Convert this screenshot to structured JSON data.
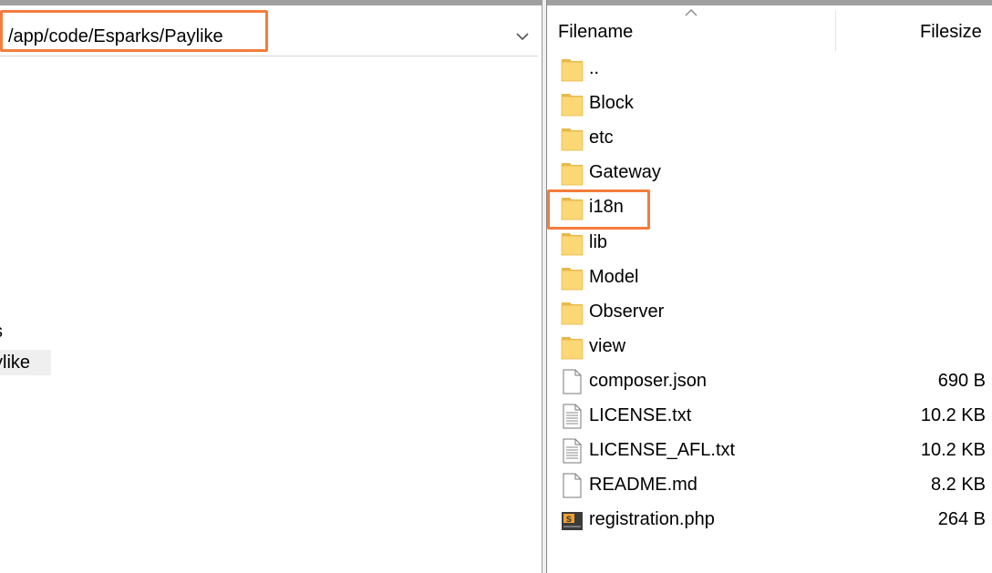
{
  "local": {
    "path_value": "/app/code/Esparks/Paylike",
    "tree_items": [
      {
        "label": "s"
      },
      {
        "label": "ylike"
      }
    ]
  },
  "remote": {
    "columns": {
      "filename": "Filename",
      "filesize": "Filesize"
    },
    "files": [
      {
        "name": "..",
        "size": "",
        "type": "folder"
      },
      {
        "name": "Block",
        "size": "",
        "type": "folder"
      },
      {
        "name": "etc",
        "size": "",
        "type": "folder"
      },
      {
        "name": "Gateway",
        "size": "",
        "type": "folder"
      },
      {
        "name": "i18n",
        "size": "",
        "type": "folder",
        "highlighted": true
      },
      {
        "name": "lib",
        "size": "",
        "type": "folder"
      },
      {
        "name": "Model",
        "size": "",
        "type": "folder"
      },
      {
        "name": "Observer",
        "size": "",
        "type": "folder"
      },
      {
        "name": "view",
        "size": "",
        "type": "folder"
      },
      {
        "name": "composer.json",
        "size": "690 B",
        "type": "file"
      },
      {
        "name": "LICENSE.txt",
        "size": "10.2 KB",
        "type": "text-file"
      },
      {
        "name": "LICENSE_AFL.txt",
        "size": "10.2 KB",
        "type": "text-file"
      },
      {
        "name": "README.md",
        "size": "8.2 KB",
        "type": "file"
      },
      {
        "name": "registration.php",
        "size": "264 B",
        "type": "php-file"
      }
    ]
  },
  "colors": {
    "highlight": "#f47c3c",
    "folder": "#fbd776",
    "folder_dark": "#e8b94a"
  },
  "icons": {
    "folder": "folder-icon",
    "file": "file-icon",
    "text_file": "text-file-icon",
    "php_file": "php-file-icon",
    "dropdown": "chevron-down-icon",
    "sort": "sort-ascending-icon"
  }
}
